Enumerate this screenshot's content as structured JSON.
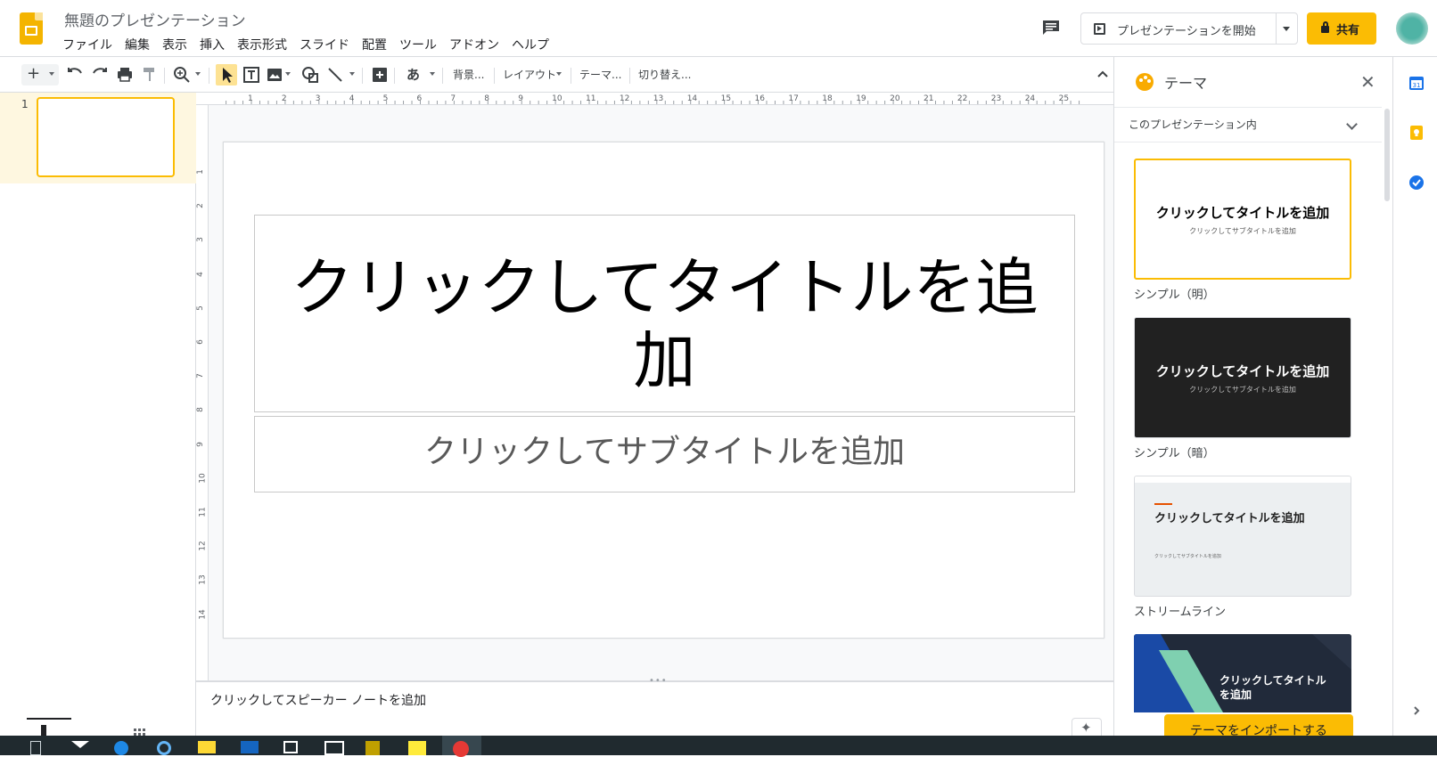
{
  "app": {
    "title": "無題のプレゼンテーション",
    "menu": [
      "ファイル",
      "編集",
      "表示",
      "挿入",
      "表示形式",
      "スライド",
      "配置",
      "ツール",
      "アドオン",
      "ヘルプ"
    ]
  },
  "header": {
    "present_label": "プレゼンテーションを開始",
    "share_label": "共有"
  },
  "toolbar": {
    "background": "背景...",
    "layout": "レイアウト",
    "theme": "テーマ...",
    "transition": "切り替え...",
    "input_tools": "あ"
  },
  "filmstrip": {
    "slides": [
      {
        "number": "1"
      }
    ]
  },
  "slide": {
    "title_placeholder": "クリックしてタイトルを追加",
    "subtitle_placeholder": "クリックしてサブタイトルを追加"
  },
  "notes": {
    "placeholder": "クリックしてスピーカー ノートを追加"
  },
  "ruler": {
    "top": [
      "1",
      "2",
      "3",
      "4",
      "5",
      "6",
      "7",
      "8",
      "9",
      "10",
      "11",
      "12",
      "13",
      "14",
      "15",
      "16",
      "17",
      "18",
      "19",
      "20",
      "21",
      "22",
      "23",
      "24",
      "25"
    ],
    "left": [
      "1",
      "2",
      "3",
      "4",
      "5",
      "6",
      "7",
      "8",
      "9",
      "10",
      "11",
      "12",
      "13",
      "14"
    ]
  },
  "theme_panel": {
    "title": "テーマ",
    "dropdown": "このプレゼンテーション内",
    "themes": [
      {
        "name": "シンプル（明）",
        "preview_title": "クリックしてタイトルを追加",
        "preview_subtitle": "クリックしてサブタイトルを追加"
      },
      {
        "name": "シンプル（暗）",
        "preview_title": "クリックしてタイトルを追加",
        "preview_subtitle": "クリックしてサブタイトルを追加"
      },
      {
        "name": "ストリームライン",
        "preview_title": "クリックしてタイトルを追加",
        "preview_subtitle": "クリックしてサブタイトルを追加"
      },
      {
        "name": "",
        "preview_title": "クリックしてタイトルを追加"
      }
    ],
    "import_label": "テーマをインポートする"
  },
  "colors": {
    "accent": "#fbbc04",
    "selected_row": "#fef7e0",
    "dark_theme": "#212121",
    "streamline_bg": "#eceff1",
    "taskbar": "#202a2f"
  },
  "icons": [
    "slides-logo-icon",
    "comments-icon",
    "present-icon",
    "lock-icon",
    "palette-icon",
    "close-icon",
    "chevron-down-icon",
    "calendar-icon",
    "keep-icon",
    "tasks-icon",
    "explore-icon"
  ]
}
